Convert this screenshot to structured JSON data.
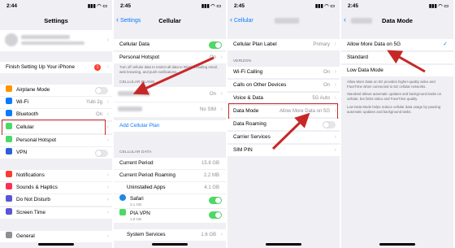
{
  "colors": {
    "accent": "#0a7aff",
    "toggle_on": "#4cd964",
    "highlight": "#c62828",
    "badge": "#ff3b30"
  },
  "screen1": {
    "time": "2:44",
    "title": "Settings",
    "finish_setup": "Finish Setting Up Your iPhone",
    "finish_badge": "1",
    "rows": [
      {
        "label": "Airplane Mode",
        "icon": "airplane-icon",
        "color": "#ff9500"
      },
      {
        "label": "Wi-Fi",
        "icon": "wifi-icon",
        "color": "#0a7aff",
        "value": "Yubi 2g"
      },
      {
        "label": "Bluetooth",
        "icon": "bluetooth-icon",
        "color": "#0a7aff",
        "value": "On"
      },
      {
        "label": "Cellular",
        "icon": "cellular-icon",
        "color": "#4cd964"
      },
      {
        "label": "Personal Hotspot",
        "icon": "hotspot-icon",
        "color": "#4cd964"
      },
      {
        "label": "VPN",
        "icon": "vpn-icon",
        "color": "#2a62d6"
      }
    ],
    "rows2": [
      {
        "label": "Notifications",
        "icon": "notifications-icon",
        "color": "#ff3b30"
      },
      {
        "label": "Sounds & Haptics",
        "icon": "sounds-icon",
        "color": "#ff2d55"
      },
      {
        "label": "Do Not Disturb",
        "icon": "moon-icon",
        "color": "#5856d6"
      },
      {
        "label": "Screen Time",
        "icon": "hourglass-icon",
        "color": "#5856d6"
      }
    ],
    "general": "General"
  },
  "screen2": {
    "time": "2:45",
    "back": "Settings",
    "title": "Cellular",
    "cellular_data": "Cellular Data",
    "personal_hotspot": "Personal Hotspot",
    "hotspot_value": "On",
    "hotspot_note": "Turn off cellular data to restrict all data to Wi-Fi, including email, web browsing, and push notifications.",
    "plans_header": "CELLULAR PLANS",
    "plan1_value": "On",
    "plan2_value": "No SIM",
    "add_plan": "Add Cellular Plan",
    "data_header": "CELLULAR DATA",
    "data_rows": [
      {
        "label": "Current Period",
        "value": "15.8 GB"
      },
      {
        "label": "Current Period Roaming",
        "value": "2.2 MB"
      },
      {
        "label": "Uninstalled Apps",
        "value": "4.1 GB"
      }
    ],
    "apps": [
      {
        "name": "Safari",
        "size": "3.1 GB",
        "icon": "safari-icon",
        "color": "#1e88e5"
      },
      {
        "name": "PIA VPN",
        "size": "1.8 GB",
        "icon": "vpn-icon",
        "color": "#4cd964"
      }
    ],
    "system_services": "System Services",
    "system_value": "1.6 GB"
  },
  "screen3": {
    "time": "2:45",
    "back": "Cellular",
    "plan_label": "Cellular Plan Label",
    "plan_value": "Primary",
    "section": "VERIZON",
    "rows": [
      {
        "label": "Wi-Fi Calling",
        "value": "On"
      },
      {
        "label": "Calls on Other Devices",
        "value": "On"
      },
      {
        "label": "Voice & Data",
        "value": "5G Auto"
      }
    ],
    "data_mode": "Data Mode",
    "data_mode_value": "Allow More Data on 5G",
    "data_roaming": "Data Roaming",
    "carrier_services": "Carrier Services",
    "sim_pin": "SIM PIN"
  },
  "screen4": {
    "time": "2:45",
    "back": "",
    "title": "Data Mode",
    "options": [
      "Allow More Data on 5G",
      "Standard",
      "Low Data Mode"
    ],
    "note1": "Allow More Data on 5G provides higher-quality video and FaceTime when connected to 5G cellular networks.",
    "note2": "Standard allows automatic updates and background tasks on cellular, but limits video and FaceTime quality.",
    "note3": "Low Data Mode helps reduce cellular data usage by pausing automatic updates and background tasks."
  }
}
